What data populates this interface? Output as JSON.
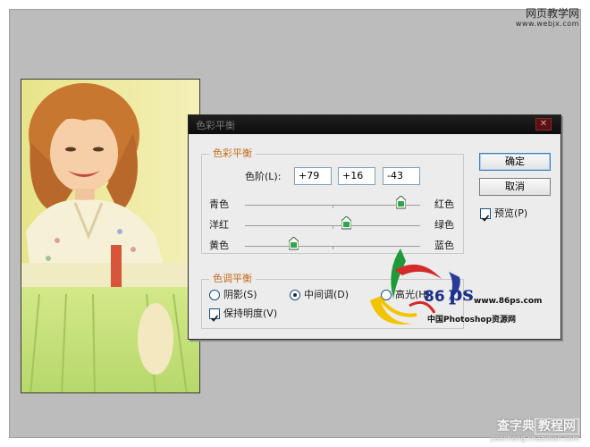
{
  "watermark_top": {
    "line1": "网页教学网",
    "line2": "www.webjx.com"
  },
  "watermark_bottom": {
    "line1a": "查字典",
    "line1b": "教程网",
    "line2": "jiaocheng.chazidian.com"
  },
  "dialog": {
    "title": "色彩平衡",
    "color_balance": {
      "legend": "色彩平衡",
      "levels_label": "色阶(L):",
      "values": [
        "+79",
        "+16",
        "-43"
      ],
      "sliders": [
        {
          "left": "青色",
          "right": "红色",
          "value": 79
        },
        {
          "left": "洋红",
          "right": "绿色",
          "value": 16
        },
        {
          "left": "黄色",
          "right": "蓝色",
          "value": -43
        }
      ]
    },
    "tone_balance": {
      "legend": "色调平衡",
      "shadows": "阴影(S)",
      "midtones": "中间调(D)",
      "highlights": "高光(H)",
      "selected": "midtones",
      "preserve_luminosity": "保持明度(V)",
      "preserve_checked": true
    },
    "buttons": {
      "ok": "确定",
      "cancel": "取消",
      "preview": "预览(P)",
      "preview_checked": true
    }
  },
  "logo": {
    "number": "86",
    "letters": "ps",
    "url": "www.86ps.com",
    "caption": "中国Photoshop资源网"
  },
  "colors": {
    "accent_legend": "#c46a1a",
    "workspace": "#bcbcbc",
    "dialog_bg": "#ececec"
  }
}
